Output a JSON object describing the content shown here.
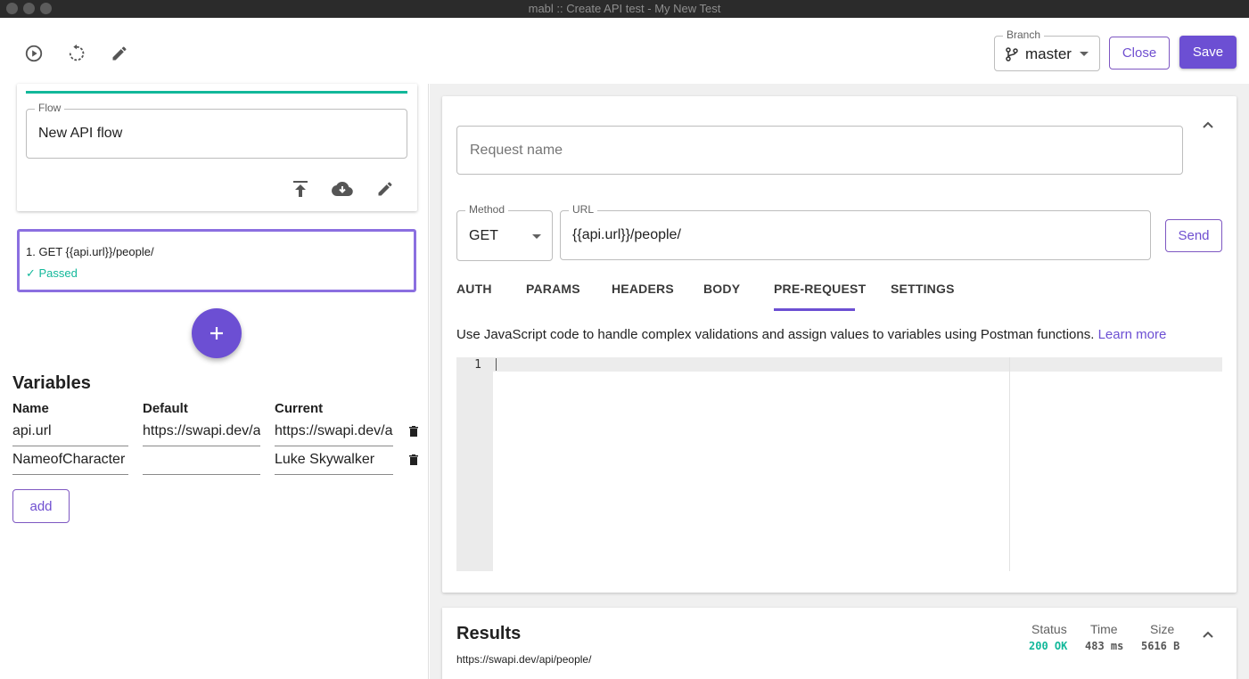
{
  "window": {
    "title": "mabl ::  Create API test - My New Test"
  },
  "toolbar": {
    "branch_label": "Branch",
    "branch_value": "master",
    "close_label": "Close",
    "save_label": "Save"
  },
  "flow": {
    "label": "Flow",
    "value": "New API flow"
  },
  "steps": [
    {
      "title": "1. GET {{api.url}}/people/",
      "status": "✓ Passed"
    }
  ],
  "variables": {
    "title": "Variables",
    "headers": {
      "name": "Name",
      "default": "Default",
      "current": "Current"
    },
    "rows": [
      {
        "name": "api.url",
        "default": "https://swapi.dev/api",
        "current": "https://swapi.dev/api"
      },
      {
        "name": "NameofCharacter",
        "default": "",
        "current": "Luke Skywalker"
      }
    ],
    "add_label": "add"
  },
  "request": {
    "name_placeholder": "Request name",
    "method_label": "Method",
    "method": "GET",
    "url_label": "URL",
    "url": "{{api.url}}/people/",
    "send_label": "Send",
    "tabs": [
      "AUTH",
      "PARAMS",
      "HEADERS",
      "BODY",
      "PRE-REQUEST",
      "SETTINGS"
    ],
    "active_tab": "PRE-REQUEST",
    "description": "Use JavaScript code to handle complex validations and assign values to variables using Postman functions.",
    "learn_more": "Learn more",
    "editor": {
      "line_numbers": [
        "1"
      ]
    }
  },
  "results": {
    "title": "Results",
    "url": "https://swapi.dev/api/people/",
    "status_label": "Status",
    "status_value": "200 OK",
    "time_label": "Time",
    "time_value": "483 ms",
    "size_label": "Size",
    "size_value": "5616 B",
    "status_color": "#12b89a"
  },
  "colors": {
    "accent": "#6c4fd3",
    "success": "#12b89a"
  }
}
